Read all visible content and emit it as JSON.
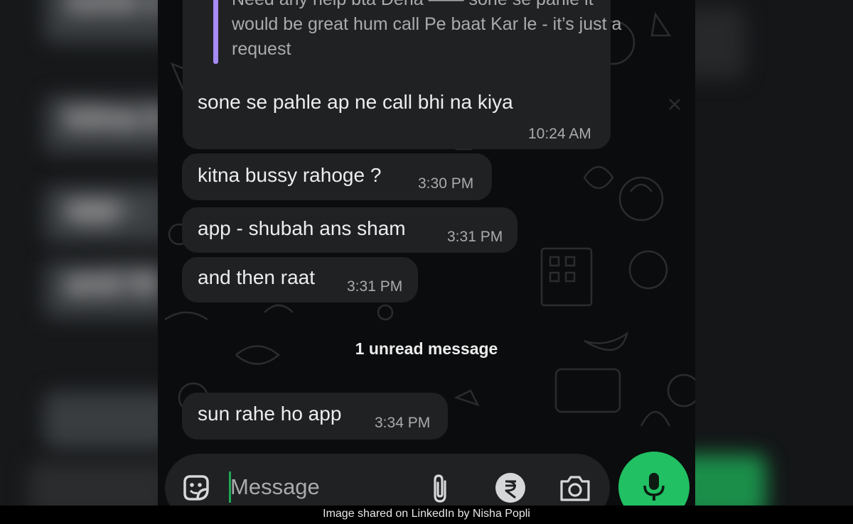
{
  "blurred_background": [
    "sone s",
    "kitna b",
    "app -",
    "and th"
  ],
  "messages": {
    "first": {
      "quoted_text": "Need any help bta Dena —— sone se pahle it would be great hum call Pe baat Kar le - it’s just a request",
      "text": "sone se pahle ap ne call bhi na kiya",
      "time": "10:24 AM"
    },
    "m2": {
      "text": "kitna bussy rahoge ?",
      "time": "3:30 PM"
    },
    "m3": {
      "text": "app - shubah ans sham",
      "time": "3:31 PM"
    },
    "m4": {
      "text": "and then raat",
      "time": "3:31 PM"
    },
    "m5": {
      "text": "sun rahe ho app",
      "time": "3:34 PM"
    }
  },
  "unread_divider": "1 unread message",
  "composer": {
    "placeholder": "Message",
    "icons": [
      "sticker-icon",
      "paperclip-icon",
      "rupee-icon",
      "camera-icon",
      "microphone-icon"
    ]
  },
  "caption": "Image shared on LinkedIn by Nisha Popli",
  "colors": {
    "accent_green": "#21c063",
    "quote_bar": "#a58bf3",
    "bubble": "#1f2123",
    "background": "#0b0c0d"
  }
}
